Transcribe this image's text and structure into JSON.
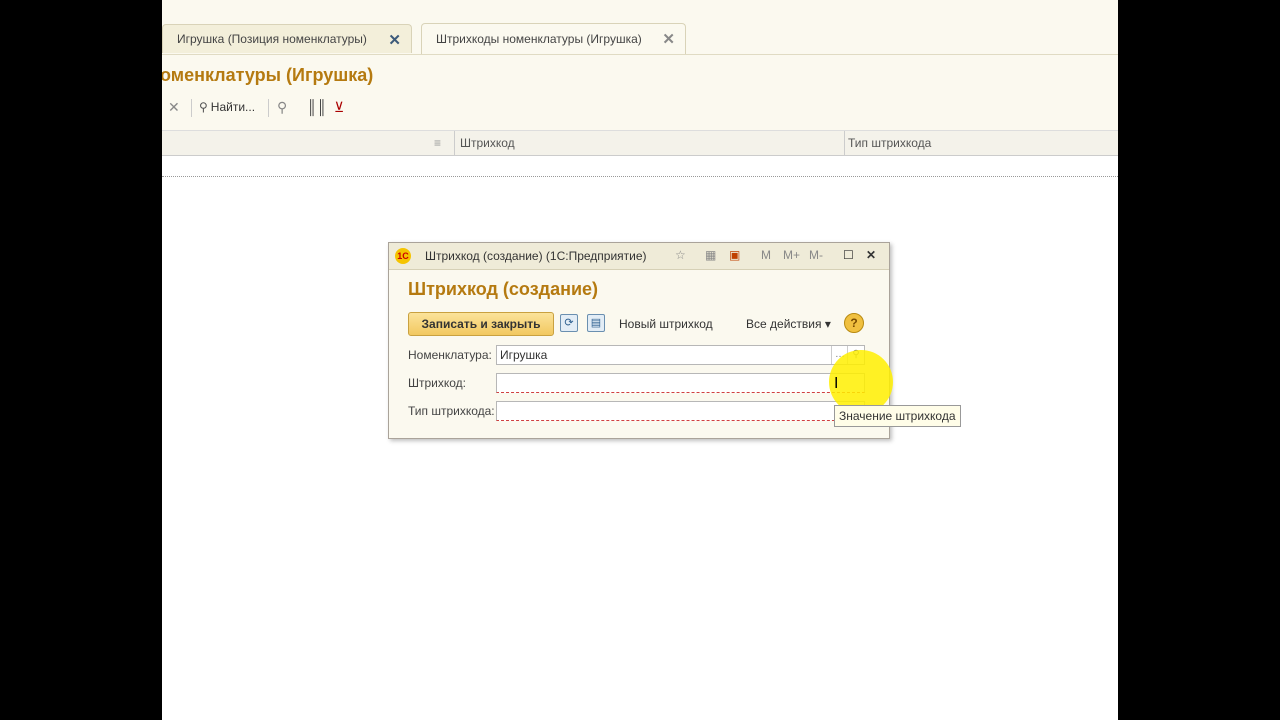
{
  "tabs": [
    {
      "label": "Игрушка (Позиция номенклатуры)"
    },
    {
      "label": "Штрихкоды номенклатуры (Игрушка)"
    }
  ],
  "page": {
    "title": "оменклатуры (Игрушка)",
    "find_label": "Найти..."
  },
  "columns": [
    "Штрихкод",
    "Тип штрихкода"
  ],
  "dialog": {
    "titlebar": "Штрихкод (создание)  (1С:Предприятие)",
    "logo_text": "1С",
    "heading": "Штрихкод (создание)",
    "save_close_label": "Записать и закрыть",
    "new_barcode_label": "Новый штрихкод",
    "all_actions_label": "Все действия",
    "mem_labels": [
      "M",
      "M+",
      "M-"
    ],
    "fields": [
      {
        "label": "Номенклатура:",
        "value": "Игрушка"
      },
      {
        "label": "Штрихкод:",
        "value": ""
      },
      {
        "label": "Тип штрихкода:",
        "value": ""
      }
    ]
  },
  "tooltip": "Значение штрихкода",
  "icons": {
    "close": "✕",
    "search": "🔍",
    "help": "?",
    "dropdown": "▾"
  }
}
